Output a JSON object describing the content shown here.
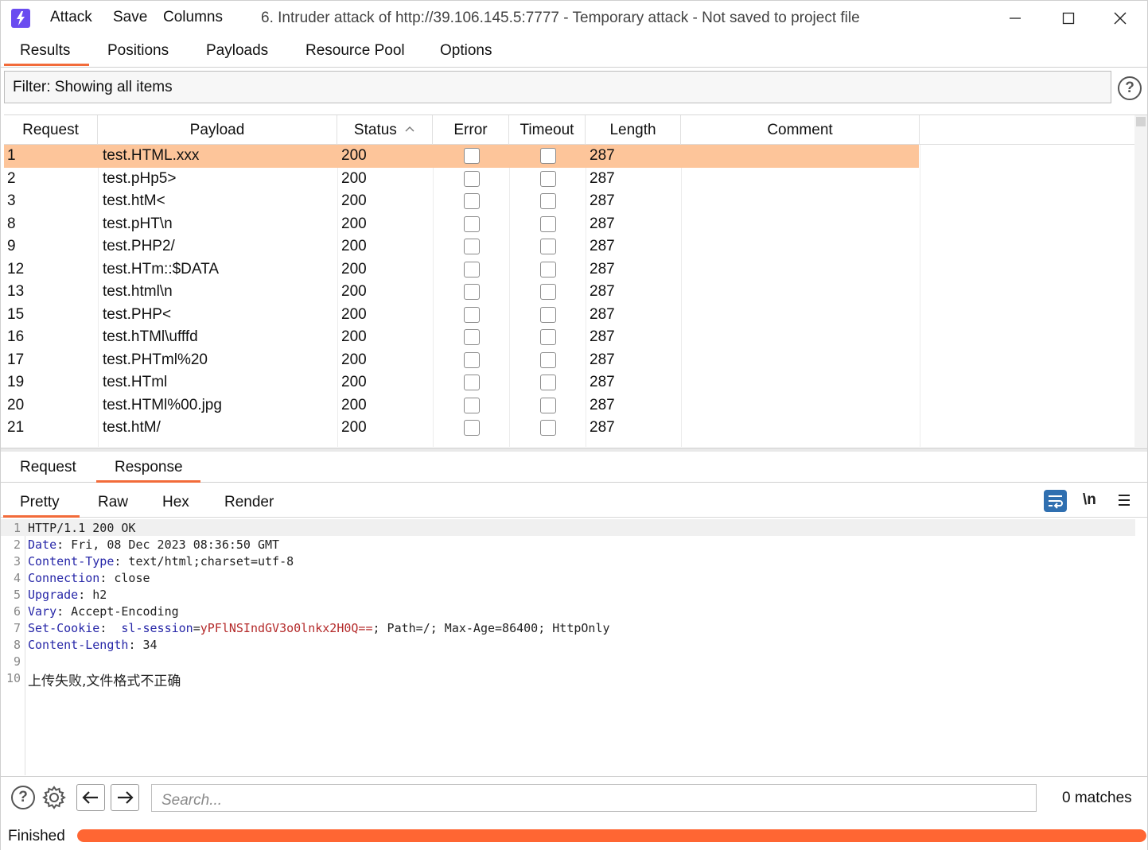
{
  "titlebar": {
    "menus": [
      "Attack",
      "Save",
      "Columns"
    ],
    "title": "6. Intruder attack of http://39.106.145.5:7777 - Temporary attack - Not saved to project file"
  },
  "main_tabs": [
    "Results",
    "Positions",
    "Payloads",
    "Resource Pool",
    "Options"
  ],
  "filter": {
    "label": "Filter: Showing all items"
  },
  "table": {
    "columns": [
      "Request",
      "Payload",
      "Status",
      "Error",
      "Timeout",
      "Length",
      "Comment"
    ],
    "sort_indicator": "^",
    "rows": [
      {
        "request": "1",
        "payload": "test.HTML.xxx",
        "status": "200",
        "length": "287"
      },
      {
        "request": "2",
        "payload": "test.pHp5>",
        "status": "200",
        "length": "287"
      },
      {
        "request": "3",
        "payload": "test.htM<",
        "status": "200",
        "length": "287"
      },
      {
        "request": "8",
        "payload": "test.pHT\\n",
        "status": "200",
        "length": "287"
      },
      {
        "request": "9",
        "payload": "test.PHP2/",
        "status": "200",
        "length": "287"
      },
      {
        "request": "12",
        "payload": "test.HTm::$DATA",
        "status": "200",
        "length": "287"
      },
      {
        "request": "13",
        "payload": "test.html\\n",
        "status": "200",
        "length": "287"
      },
      {
        "request": "15",
        "payload": "test.PHP<",
        "status": "200",
        "length": "287"
      },
      {
        "request": "16",
        "payload": "test.hTMl\\ufffd",
        "status": "200",
        "length": "287"
      },
      {
        "request": "17",
        "payload": "test.PHTml%20",
        "status": "200",
        "length": "287"
      },
      {
        "request": "19",
        "payload": "test.HTml",
        "status": "200",
        "length": "287"
      },
      {
        "request": "20",
        "payload": "test.HTMl%00.jpg",
        "status": "200",
        "length": "287"
      },
      {
        "request": "21",
        "payload": "test.htM/",
        "status": "200",
        "length": "287"
      }
    ]
  },
  "message_tabs": [
    "Request",
    "Response"
  ],
  "view_tabs": [
    "Pretty",
    "Raw",
    "Hex",
    "Render"
  ],
  "view_tools": {
    "newline_label": "\\n"
  },
  "response": {
    "line_numbers": [
      "1",
      "2",
      "3",
      "4",
      "5",
      "6",
      "7",
      "8",
      "9",
      "10"
    ],
    "status_line": "HTTP/1.1 200 OK",
    "headers": [
      {
        "name": "Date",
        "value": " Fri, 08 Dec 2023 08:36:50 GMT"
      },
      {
        "name": "Content-Type",
        "value": " text/html;charset=utf-8"
      },
      {
        "name": "Connection",
        "value": " close"
      },
      {
        "name": "Upgrade",
        "value": " h2"
      },
      {
        "name": "Vary",
        "value": " Accept-Encoding"
      }
    ],
    "cookie": {
      "header": "Set-Cookie",
      "name": "sl-session",
      "value": "yPFlNSIndGV3o0lnkx2H0Q==",
      "rest": "; Path=/; Max-Age=86400; HttpOnly"
    },
    "content_length": {
      "name": "Content-Length",
      "value": " 34"
    },
    "body": "上传失败,文件格式不正确"
  },
  "search": {
    "placeholder": "Search..."
  },
  "matches": "0 matches",
  "status": {
    "text": "Finished",
    "progress": 1.0,
    "color": "#ff6633"
  }
}
